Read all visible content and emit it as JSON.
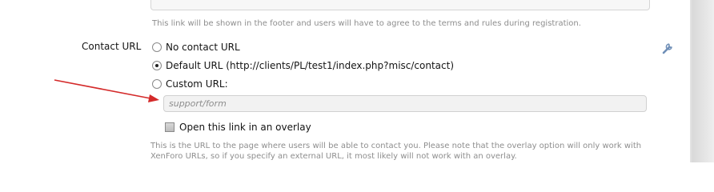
{
  "top_explain": "This link will be shown in the footer and users will have to agree to the terms and rules during registration.",
  "contact": {
    "label": "Contact URL",
    "options": [
      {
        "label": "No contact URL",
        "checked": false
      },
      {
        "label": "Default URL (http://clients/PL/test1/index.php?misc/contact)",
        "checked": true
      },
      {
        "label": "Custom URL:",
        "checked": false
      }
    ],
    "custom_url": {
      "value": "",
      "placeholder": "support/form"
    },
    "overlay": {
      "label": "Open this link in an overlay",
      "checked": false
    },
    "explain_line1": "This is the URL to the page where users will be able to contact you. Please note that the overlay option will only work with",
    "explain_line2": "XenForo URLs, so if you specify an external URL, it most likely will not work with an overlay."
  },
  "colors": {
    "annotation_arrow": "#d42a2a",
    "explain_text": "#8e8e8e",
    "wrench_icon": "#6f8fb7"
  },
  "icons": {
    "edit": "wrench-icon",
    "annotation": "red-arrow"
  }
}
